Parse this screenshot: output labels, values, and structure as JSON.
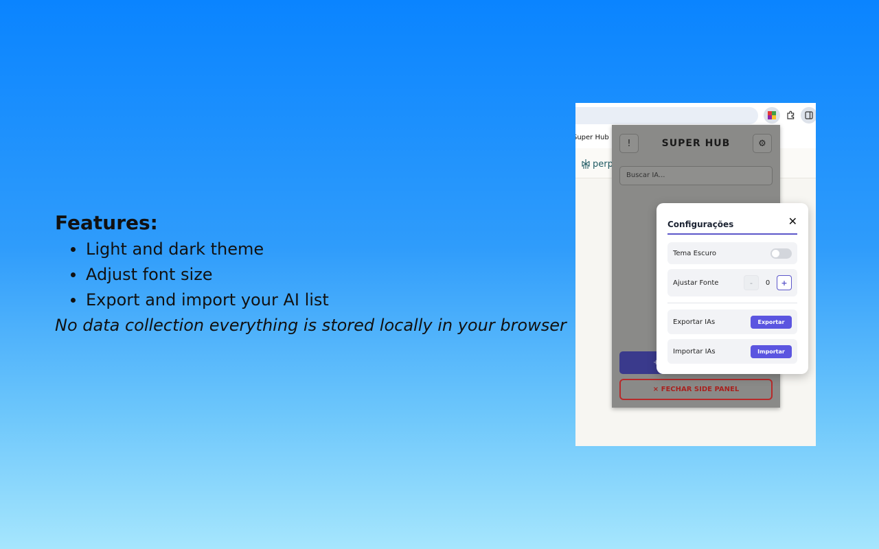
{
  "features": {
    "heading": "Features:",
    "items": [
      "Light and dark theme",
      "Adjust font size",
      "Export and import your AI list"
    ],
    "note": "No data collection everything is stored locally in your browser"
  },
  "browser": {
    "tab_title": "Super Hub",
    "page_brand": "perp",
    "page_fragment": "?"
  },
  "side_panel": {
    "title": "SUPER HUB",
    "info_button": "!",
    "settings_icon": "gear-icon",
    "search_placeholder": "Buscar IA...",
    "add_button": "+ ADICIONAR NOVA IA",
    "close_button": "× FECHAR SIDE PANEL"
  },
  "settings_modal": {
    "title": "Configurações",
    "close": "✕",
    "dark_theme_label": "Tema Escuro",
    "dark_theme_on": false,
    "font_label": "Ajustar Fonte",
    "font_minus": "-",
    "font_value": "0",
    "font_plus": "+",
    "export_label": "Exportar IAs",
    "export_button": "Exportar",
    "import_label": "Importar IAs",
    "import_button": "Importar"
  },
  "colors": {
    "accent": "#5b55e0",
    "danger": "#b72a2a"
  }
}
